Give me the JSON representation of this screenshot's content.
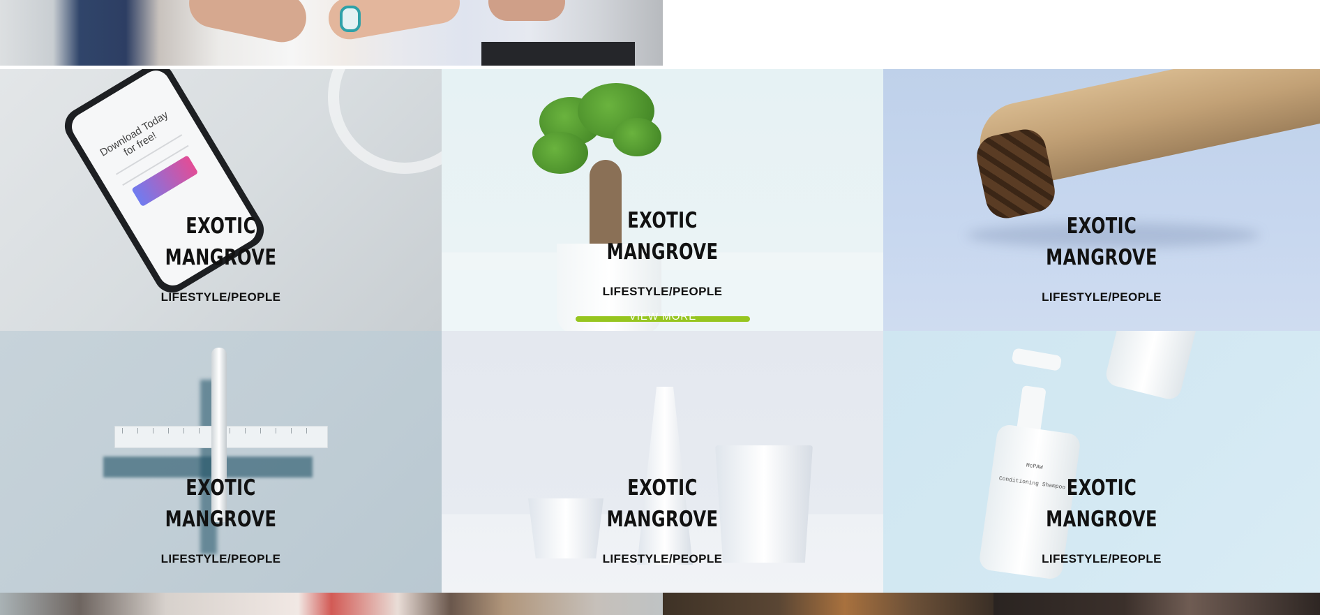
{
  "tiles": [
    {
      "title_line1": "EXOTIC",
      "title_line2": "MANGROVE",
      "category": "LIFESTYLE/PEOPLE"
    },
    {
      "title_line1": "EXOTIC",
      "title_line2": "MANGROVE",
      "category": "LIFESTYLE/PEOPLE",
      "view_more": "VIEW MORE"
    },
    {
      "title_line1": "EXOTIC",
      "title_line2": "MANGROVE",
      "category": "LIFESTYLE/PEOPLE"
    },
    {
      "title_line1": "EXOTIC",
      "title_line2": "MANGROVE",
      "category": "LIFESTYLE/PEOPLE"
    },
    {
      "title_line1": "EXOTIC",
      "title_line2": "MANGROVE",
      "category": "LIFESTYLE/PEOPLE"
    },
    {
      "title_line1": "EXOTIC",
      "title_line2": "MANGROVE",
      "category": "LIFESTYLE/PEOPLE"
    }
  ],
  "phone_screen": {
    "heading": "Download Today for free!"
  },
  "shampoo_label": {
    "brand": "McPAW",
    "product": "Conditioning Shampoo"
  },
  "colors": {
    "accent": "#96c51f",
    "text": "#111111"
  }
}
